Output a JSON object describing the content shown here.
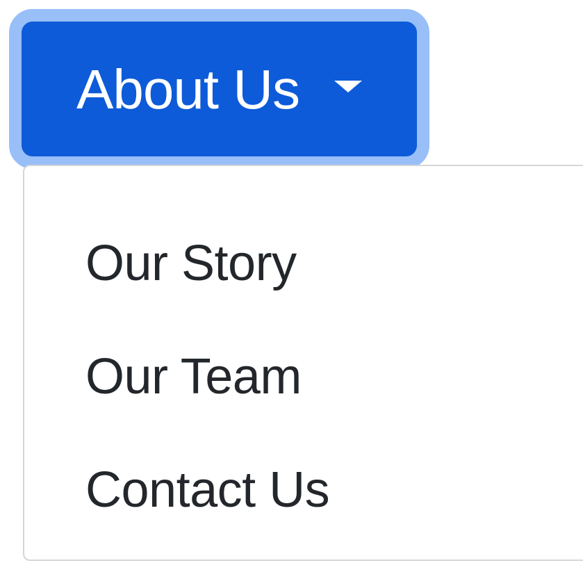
{
  "dropdown": {
    "toggle_label": "About Us",
    "toggle_icon": "caret-down-icon",
    "items": [
      {
        "label": "Our Story"
      },
      {
        "label": "Our Team"
      },
      {
        "label": "Contact Us"
      }
    ]
  },
  "colors": {
    "button_background": "#0d5bd8",
    "focus_ring": "#98bff8",
    "menu_border": "#d6d6d6",
    "menu_text": "#23272b"
  }
}
